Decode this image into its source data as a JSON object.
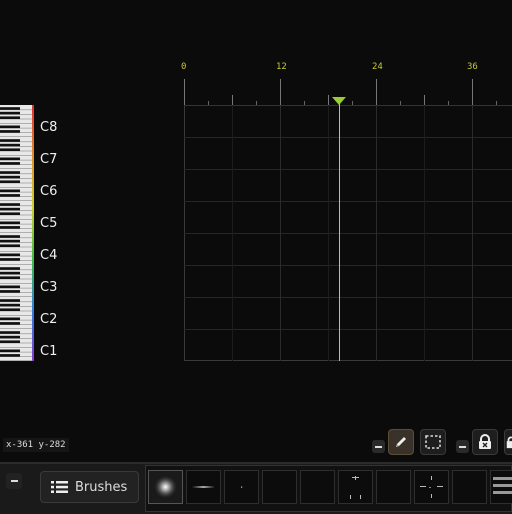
{
  "ruler": {
    "labels": [
      "0",
      "12",
      "24",
      "36"
    ]
  },
  "notes": [
    "C8",
    "C7",
    "C6",
    "C5",
    "C4",
    "C3",
    "C2",
    "C1"
  ],
  "status": {
    "coords": "x-361 y-282"
  },
  "toolbar": {
    "brushes_label": "Brushes"
  },
  "icons": {
    "playhead": "triangle-marker",
    "pencil": "pencil-icon",
    "select": "selection-rect-icon",
    "lock": "lock-icon",
    "list": "list-icon"
  },
  "colors": {
    "accent": "#c8c832",
    "playhead": "#9acd32",
    "background": "#0b0b0b"
  }
}
